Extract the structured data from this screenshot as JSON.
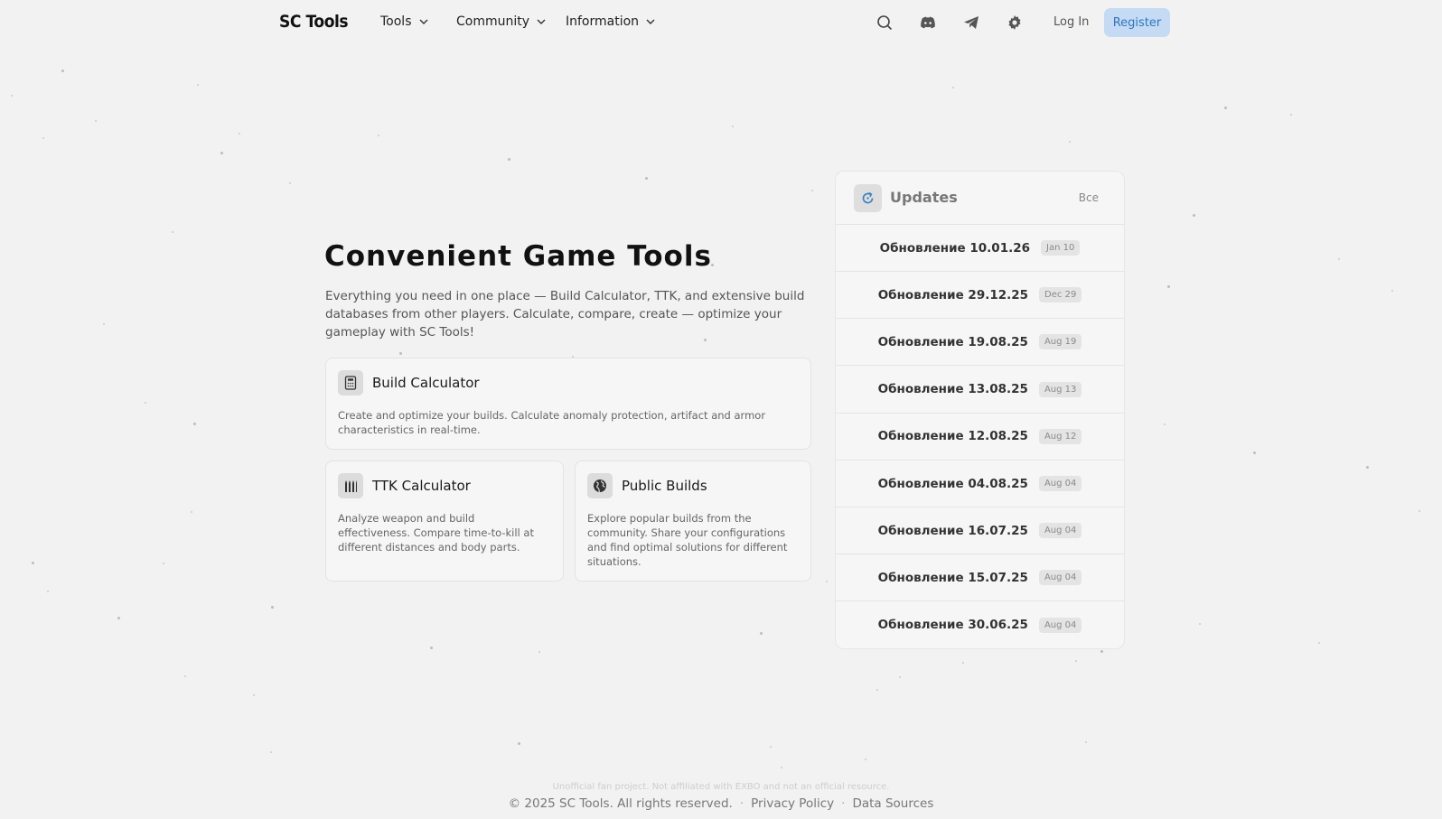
{
  "header": {
    "logo": "SC Tools",
    "nav": [
      {
        "label": "Tools"
      },
      {
        "label": "Community"
      },
      {
        "label": "Information"
      }
    ],
    "icons": [
      "search-icon",
      "discord-icon",
      "telegram-icon",
      "settings-icon"
    ],
    "login": "Log In",
    "register": "Register"
  },
  "hero": {
    "title": "Convenient Game Tools",
    "description": "Everything you need in one place — Build Calculator, TTK, and extensive build databases from other players. Calculate, compare, create — optimize your gameplay with SC Tools!"
  },
  "cards": [
    {
      "icon": "calculator-icon",
      "title": "Build Calculator",
      "description": "Create and optimize your builds. Calculate anomaly protection, artifact and armor characteristics in real-time."
    },
    {
      "icon": "ammo-icon",
      "title": "TTK Calculator",
      "description": "Analyze weapon and build effectiveness. Compare time-to-kill at different distances and body parts."
    },
    {
      "icon": "globe-icon",
      "title": "Public Builds",
      "description": "Explore popular builds from the community. Share your configurations and find optimal solutions for different situations."
    }
  ],
  "updates": {
    "title": "Updates",
    "all_label": "Все",
    "items": [
      {
        "name": "Обновление 10.01.26",
        "date": "Jan 10"
      },
      {
        "name": "Обновление 29.12.25",
        "date": "Dec 29"
      },
      {
        "name": "Обновление 19.08.25",
        "date": "Aug 19"
      },
      {
        "name": "Обновление 13.08.25",
        "date": "Aug 13"
      },
      {
        "name": "Обновление 12.08.25",
        "date": "Aug 12"
      },
      {
        "name": "Обновление 04.08.25",
        "date": "Aug 04"
      },
      {
        "name": "Обновление 16.07.25",
        "date": "Aug 04"
      },
      {
        "name": "Обновление 15.07.25",
        "date": "Aug 04"
      },
      {
        "name": "Обновление 30.06.25",
        "date": "Aug 04"
      }
    ]
  },
  "footer": {
    "note": "Unofficial fan project. Not affiliated with EXBO and not an official resource.",
    "copyright": "© 2025 SC Tools. All rights reserved.",
    "privacy": "Privacy Policy",
    "sources": "Data Sources"
  },
  "colors": {
    "background": "#f2f2f2",
    "register_bg": "#c4dbf3",
    "register_text": "#2f74c2",
    "update_icon": "#3b82c4"
  }
}
